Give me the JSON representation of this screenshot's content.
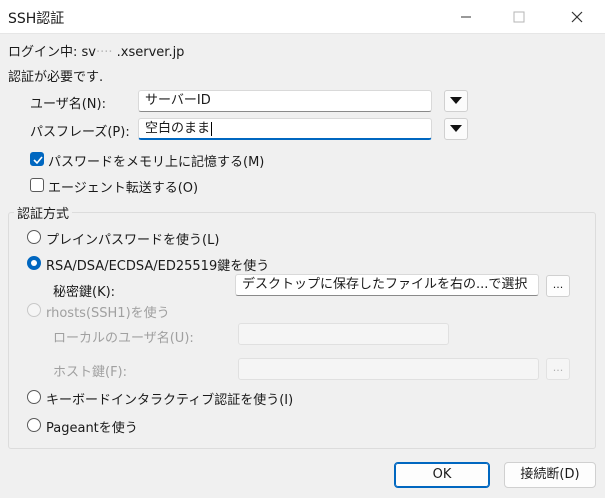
{
  "window": {
    "title": "SSH認証"
  },
  "header": {
    "login_prefix": "ログイン中: sv",
    "login_host_suffix": ".xserver.jp",
    "auth_required": "認証が必要です."
  },
  "username": {
    "label": "ユーザ名(N):",
    "value": "サーバーID"
  },
  "passphrase": {
    "label": "パスフレーズ(P):",
    "value": "空白のまま"
  },
  "options": {
    "remember_password": {
      "label": "パスワードをメモリ上に記憶する(M)",
      "checked": true
    },
    "agent_forwarding": {
      "label": "エージェント転送する(O)",
      "checked": false
    }
  },
  "auth_method": {
    "group_label": "認証方式",
    "plain_password": {
      "label": "プレインパスワードを使う(L)",
      "selected": false
    },
    "rsa_key": {
      "label": "RSA/DSA/ECDSA/ED25519鍵を使う",
      "selected": true
    },
    "private_key": {
      "label": "秘密鍵(K):",
      "value": "デスクトップに保存したファイルを右の...で選択",
      "browse_label": "..."
    },
    "rhosts": {
      "label": "rhosts(SSH1)を使う",
      "selected": false,
      "disabled": true
    },
    "local_user": {
      "label": "ローカルのユーザ名(U):",
      "value": ""
    },
    "host_key": {
      "label": "ホスト鍵(F):",
      "value": "",
      "browse_label": "..."
    },
    "keyboard_interactive": {
      "label": "キーボードインタラクティブ認証を使う(I)",
      "selected": false
    },
    "pageant": {
      "label": "Pageantを使う",
      "selected": false
    }
  },
  "buttons": {
    "ok": "OK",
    "disconnect": "接続断(D)"
  },
  "colors": {
    "accent": "#0067c0"
  }
}
